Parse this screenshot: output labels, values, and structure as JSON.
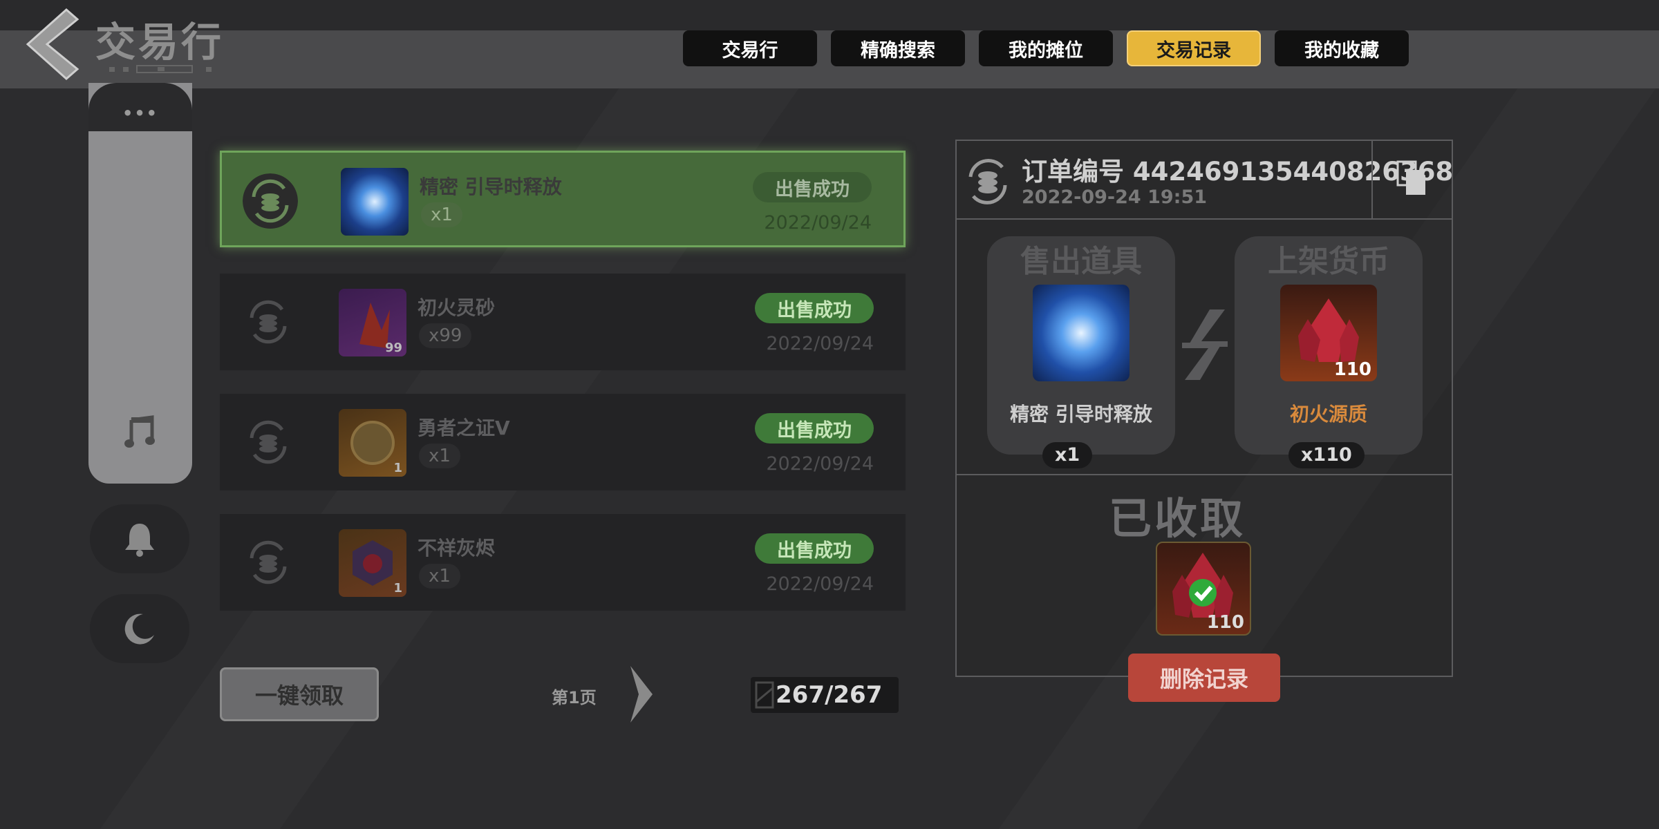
{
  "header": {
    "title": "交易行",
    "tabs": [
      {
        "label": "交易行",
        "active": false
      },
      {
        "label": "精确搜索",
        "active": false
      },
      {
        "label": "我的摊位",
        "active": false
      },
      {
        "label": "交易记录",
        "active": true
      },
      {
        "label": "我的收藏",
        "active": false
      }
    ]
  },
  "side_dock": {
    "more_label": "•••",
    "icons": [
      "music-note-icon",
      "bell-icon",
      "moon-icon"
    ]
  },
  "records": [
    {
      "name": "精密 引导时释放",
      "qty": "x1",
      "status": "出售成功",
      "date": "2022/09/24",
      "selected": true,
      "thumb": "blue-vortex-orb"
    },
    {
      "name": "初火灵砂",
      "qty": "x99",
      "status": "出售成功",
      "date": "2022/09/24",
      "selected": false,
      "thumb": "red-crystal-shard",
      "thumb_count": "99"
    },
    {
      "name": "勇者之证V",
      "qty": "x1",
      "status": "出售成功",
      "date": "2022/09/24",
      "selected": false,
      "thumb": "bronze-medal",
      "thumb_count": "1"
    },
    {
      "name": "不祥灰烬",
      "qty": "x1",
      "status": "出售成功",
      "date": "2022/09/24",
      "selected": false,
      "thumb": "dark-ash-orb",
      "thumb_count": "1"
    }
  ],
  "footer": {
    "claim_all_label": "一键领取",
    "page_label": "第1页",
    "counter": "267/267"
  },
  "detail": {
    "order_id": "订单编号 442469135440826368",
    "order_time": "2022-09-24 19:51",
    "sold_item": {
      "section_title": "售出道具",
      "name": "精密 引导时释放",
      "qty": "x1"
    },
    "currency": {
      "section_title": "上架货币",
      "name": "初火源质",
      "qty": "x110",
      "badge": "110",
      "name_color": "#d98a3c"
    },
    "collected_label": "已收取",
    "collected_badge": "110",
    "delete_label": "删除记录"
  },
  "colors": {
    "accent_tab": "#e7b63a",
    "status_green": "#3f7a39",
    "delete_red": "#b8463a"
  }
}
